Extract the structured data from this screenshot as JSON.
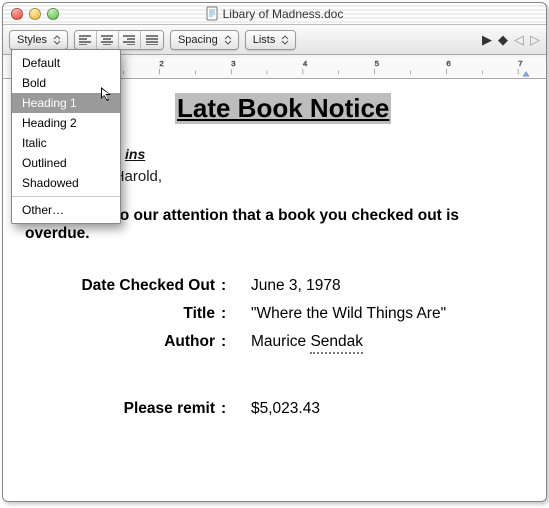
{
  "titlebar": {
    "title": "Libary of Madness.doc"
  },
  "toolbar": {
    "styles_select": "Styles",
    "spacing_select": "Spacing",
    "lists_select": "Lists",
    "align_icons": [
      "align-left",
      "align-center",
      "align-right",
      "align-justify"
    ],
    "nav_icons": [
      "triangle-right-solid",
      "diamond",
      "triangle-left-outline",
      "triangle-right-outline"
    ]
  },
  "styles_menu": {
    "items": [
      "Default",
      "Bold",
      "Heading 1",
      "Heading 2",
      "Italic",
      "Outlined",
      "Shadowed"
    ],
    "other": "Other…",
    "selected_index": 2
  },
  "document": {
    "heading": "Late Book Notice",
    "recipient_line": "ins",
    "salutation": "Dear Harold,",
    "body": "It has come to our attention that a book you checked out is overdue.",
    "details": [
      {
        "label": "Date Checked Out",
        "value": "June 3, 1978",
        "underline": false
      },
      {
        "label": "Title",
        "value": "\"Where the Wild Things Are\"",
        "underline": false
      },
      {
        "label": "Author",
        "value": "Maurice Sendak",
        "underline": true
      }
    ],
    "remit_label": "Please remit",
    "remit_value": "$5,023.43"
  }
}
